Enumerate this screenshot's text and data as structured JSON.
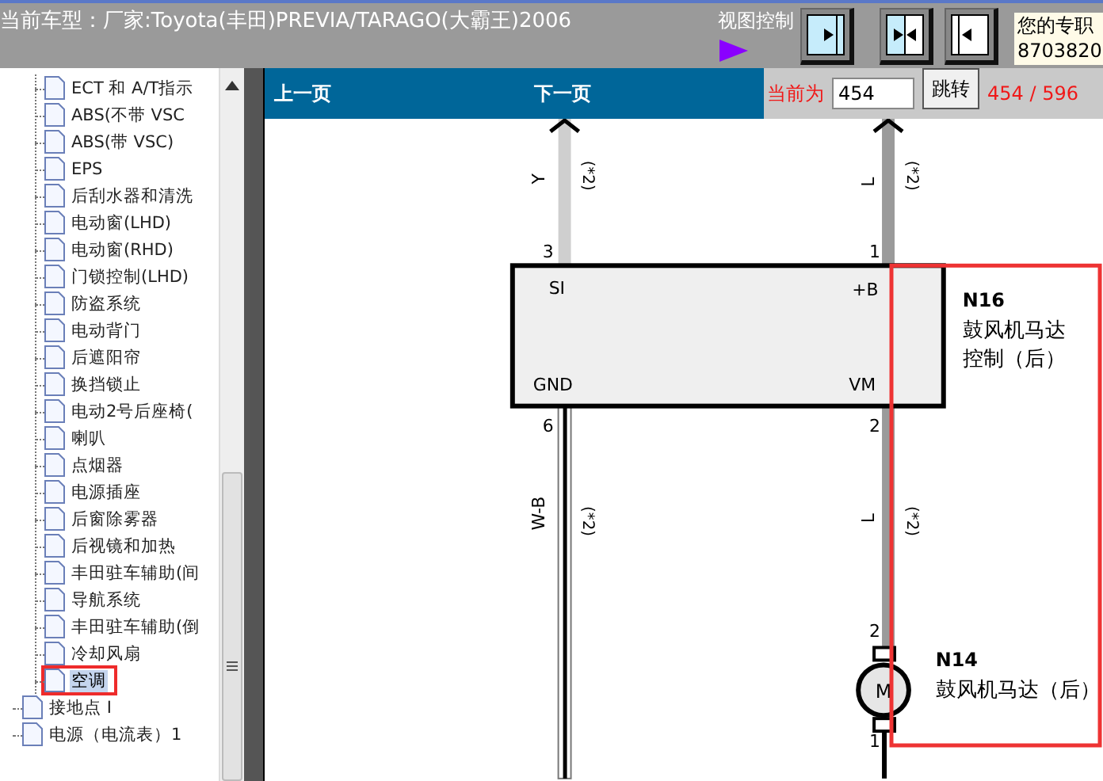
{
  "header": {
    "title": "当前车型：厂家:Toyota(丰田)PREVIA/TARAGO(大霸王)2006",
    "view_control_label": "视图控制",
    "contact_lines": [
      "您的专职",
      "8703820"
    ]
  },
  "view_buttons": [
    {
      "kind": "right"
    },
    {
      "kind": "split"
    },
    {
      "kind": "left"
    }
  ],
  "tree": {
    "items": [
      {
        "children": [
          {
            "label": "ECT 和 A/T指示",
            "selected": false,
            "highlight": false
          },
          {
            "label": "ABS(不带 VSC",
            "selected": false,
            "highlight": false
          },
          {
            "label": "ABS(带 VSC)",
            "selected": false,
            "highlight": false
          },
          {
            "label": "EPS",
            "selected": false,
            "highlight": false
          },
          {
            "label": "后刮水器和清洗",
            "selected": false,
            "highlight": false
          },
          {
            "label": "电动窗(LHD)",
            "selected": false,
            "highlight": false
          },
          {
            "label": "电动窗(RHD)",
            "selected": false,
            "highlight": false
          },
          {
            "label": "门锁控制(LHD)",
            "selected": false,
            "highlight": false
          },
          {
            "label": "防盗系统",
            "selected": false,
            "highlight": false
          },
          {
            "label": "电动背门",
            "selected": false,
            "highlight": false
          },
          {
            "label": "后遮阳帘",
            "selected": false,
            "highlight": false
          },
          {
            "label": "换挡锁止",
            "selected": false,
            "highlight": false
          },
          {
            "label": "电动2号后座椅(",
            "selected": false,
            "highlight": false
          },
          {
            "label": "喇叭",
            "selected": false,
            "highlight": false
          },
          {
            "label": "点烟器",
            "selected": false,
            "highlight": false
          },
          {
            "label": "电源插座",
            "selected": false,
            "highlight": false
          },
          {
            "label": "后窗除雾器",
            "selected": false,
            "highlight": false
          },
          {
            "label": "后视镜和加热",
            "selected": false,
            "highlight": false
          },
          {
            "label": "丰田驻车辅助(间",
            "selected": false,
            "highlight": false
          },
          {
            "label": "导航系统",
            "selected": false,
            "highlight": false
          },
          {
            "label": "丰田驻车辅助(倒",
            "selected": false,
            "highlight": false
          },
          {
            "label": "冷却风扇",
            "selected": false,
            "highlight": false
          },
          {
            "label": "空调",
            "selected": true,
            "highlight": true
          }
        ]
      },
      {
        "label": "接地点 I",
        "selected": false,
        "highlight": false
      },
      {
        "label": "电源（电流表）1",
        "selected": false,
        "highlight": false
      }
    ]
  },
  "nav": {
    "prev": "上一页",
    "next": "下一页",
    "current_label": "当前为",
    "page_input": "454",
    "go_button": "跳转",
    "page_count": "454 / 596"
  },
  "diagram": {
    "highlight": true,
    "ecu": {
      "code": "N16",
      "name_lines": [
        "鼓风机马达",
        "控制（后）"
      ],
      "pins": [
        "SI",
        "+B",
        "GND",
        "VM"
      ]
    },
    "motor": {
      "code": "N14",
      "name": "鼓风机马达（后）",
      "symbol": "M"
    },
    "pin_numbers": [
      "3",
      "1",
      "6",
      "2",
      "2",
      "1"
    ],
    "wires": [
      {
        "kind": "upper_left",
        "color_code": "Y",
        "note": "(*2)"
      },
      {
        "kind": "upper_right",
        "color_code": "L",
        "note": "(*2)"
      },
      {
        "kind": "lower_left",
        "color_code": "W-B",
        "note": "(*2)"
      },
      {
        "kind": "lower_right",
        "color_code": "L",
        "note": "(*2)"
      }
    ]
  }
}
